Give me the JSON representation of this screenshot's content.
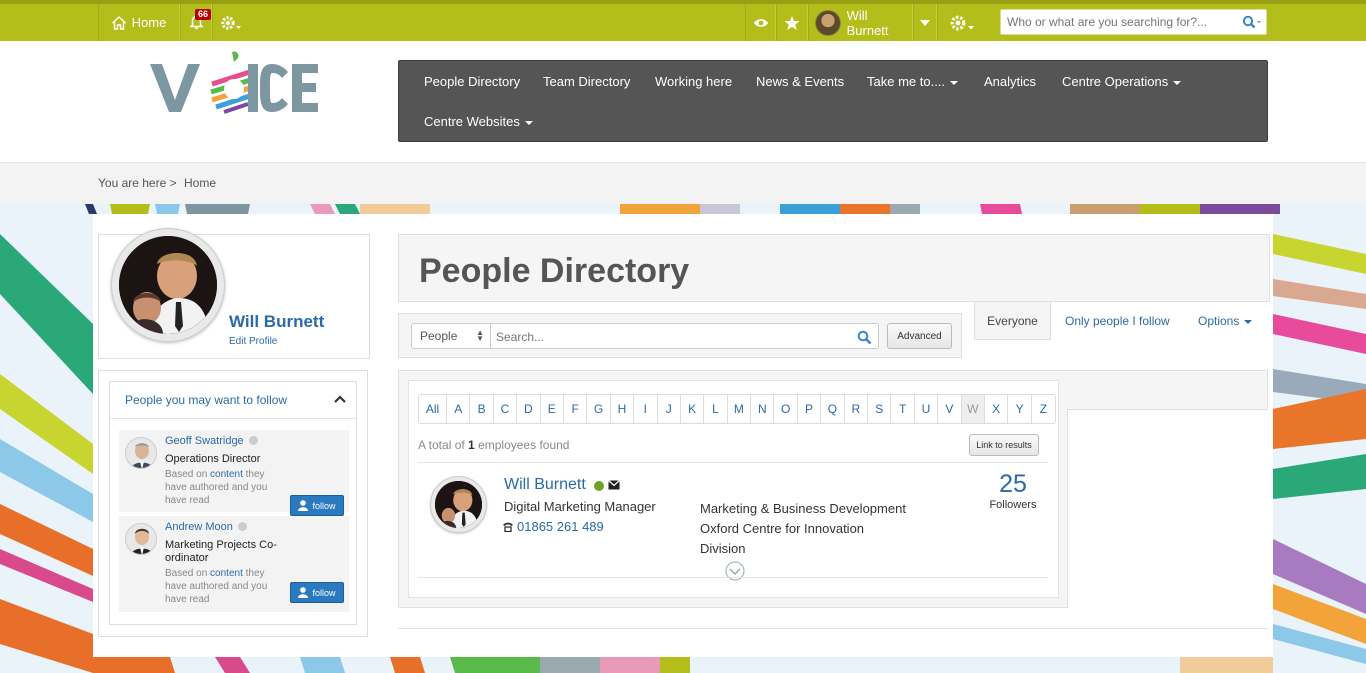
{
  "topbar": {
    "home_label": "Home",
    "notifications_count": "66",
    "user_name": "Will Burnett",
    "search_placeholder": "Who or what are you searching for?...",
    "icons": [
      "home-icon",
      "bell-icon",
      "cog-icon",
      "eye-icon",
      "star-icon",
      "caret-down-icon",
      "search-icon"
    ]
  },
  "logo": {
    "text": "VOICE"
  },
  "nav": {
    "items": [
      {
        "label": "People Directory"
      },
      {
        "label": "Team Directory"
      },
      {
        "label": "Working here"
      },
      {
        "label": "News & Events"
      },
      {
        "label": "Take me to...."
      },
      {
        "label": "Analytics"
      },
      {
        "label": "Centre Operations"
      },
      {
        "label": "Centre Websites"
      }
    ]
  },
  "breadcrumb": {
    "prefix": "You are here >",
    "current": "Home"
  },
  "profile": {
    "name": "Will Burnett",
    "edit_label": "Edit Profile"
  },
  "follow_panel": {
    "title": "People you may want to follow",
    "people": [
      {
        "name": "Geoff Swatridge",
        "role": "Operations Director",
        "reason_pre": "Based on",
        "reason_link": "content",
        "reason_post": "they have authored and you have read",
        "button": "follow"
      },
      {
        "name": "Andrew Moon",
        "role": "Marketing Projects Co-ordinator",
        "reason_pre": "Based on",
        "reason_link": "content",
        "reason_post": "they have authored and you have read",
        "button": "follow"
      }
    ]
  },
  "directory": {
    "title": "People Directory",
    "search_type": "People",
    "search_placeholder": "Search...",
    "advanced_label": "Advanced",
    "tabs": {
      "everyone": "Everyone",
      "following": "Only people I follow",
      "options": "Options"
    },
    "alphabet": [
      "All",
      "A",
      "B",
      "C",
      "D",
      "E",
      "F",
      "G",
      "H",
      "I",
      "J",
      "K",
      "L",
      "M",
      "N",
      "O",
      "P",
      "Q",
      "R",
      "S",
      "T",
      "U",
      "V",
      "W",
      "X",
      "Y",
      "Z"
    ],
    "disabled_letter": "W",
    "total_pre": "A total of",
    "total_count": "1",
    "total_post": "employees found",
    "link_results": "Link to results",
    "result": {
      "name": "Will Burnett",
      "status_color": "#6aa520",
      "title": "Digital Marketing Manager",
      "phone": "01865 261 489",
      "dept_1": "Marketing & Business Development",
      "dept_2": "Oxford Centre for Innovation",
      "dept_3": "Division",
      "followers_count": "25",
      "followers_label": "Followers"
    }
  },
  "colors": {
    "topbar": "#b4be1a",
    "nav": "#555555",
    "link": "#2a6aa8",
    "button": "#2a7ac0",
    "badge": "#b80000"
  }
}
